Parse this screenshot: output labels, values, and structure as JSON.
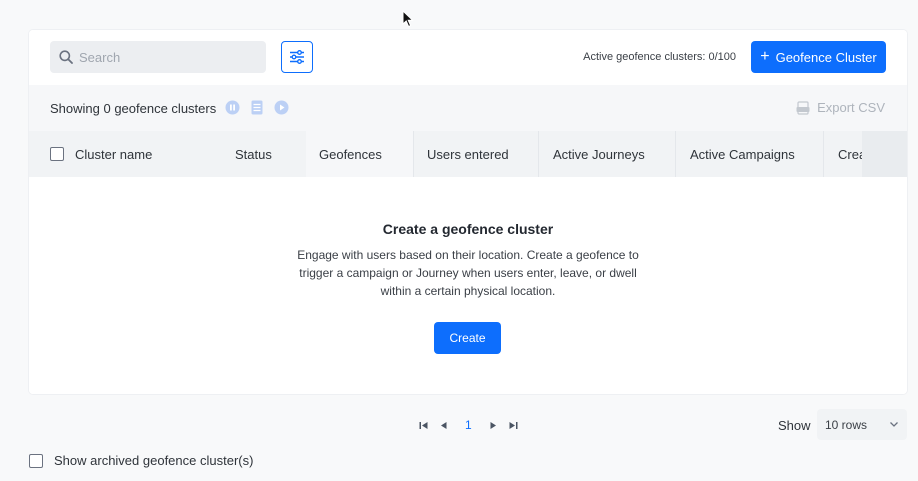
{
  "toolbar": {
    "search_placeholder": "Search",
    "active_count": "Active geofence clusters: 0/100",
    "add_button": "Geofence Cluster",
    "add_button_icon": "plus"
  },
  "subbar": {
    "showing": "Showing 0 geofence clusters",
    "export": "Export CSV",
    "icons": [
      "pause-circle-icon",
      "list-icon",
      "play-circle-icon"
    ]
  },
  "table": {
    "columns": [
      "Cluster name",
      "Status",
      "Geofences",
      "Users entered",
      "Active Journeys",
      "Active Campaigns",
      "Crea"
    ]
  },
  "empty_state": {
    "title": "Create a geofence cluster",
    "description": "Engage with users based on their location. Create a geofence to trigger a campaign or Journey when users enter, leave, or dwell within a certain physical location.",
    "create_button": "Create"
  },
  "pagination": {
    "current_page": "1",
    "show_label": "Show",
    "rows_option": "10 rows"
  },
  "archived": {
    "label": "Show archived geofence cluster(s)"
  },
  "colors": {
    "accent": "#0d6efd",
    "background": "#f8f9fa",
    "muted": "#aeb4bc"
  }
}
